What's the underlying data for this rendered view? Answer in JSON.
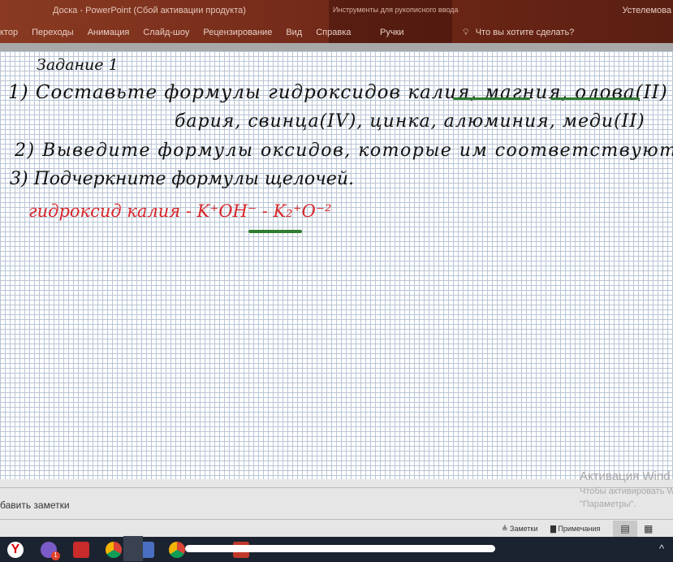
{
  "titlebar": {
    "title": "Доска  -  PowerPoint (Сбой активации продукта)",
    "context": "Инструменты для рукописного ввода",
    "user": "Устелемова"
  },
  "tabs": [
    "ктор",
    "Переходы",
    "Анимация",
    "Слайд-шоу",
    "Рецензирование",
    "Вид",
    "Справка"
  ],
  "context_tab": "Ручки",
  "tell_me": "Что вы хотите сделать?",
  "slide": {
    "heading": "Задание 1",
    "line1": "1) Составьте формулы гидроксидов калия, магния, олова(II)",
    "line2": "бария, свинца(IV), цинка, алюминия, меди(II)",
    "line3": "2) Выведите формулы оксидов, которые им соответствуют",
    "line4": "3) Подчеркните формулы щелочей.",
    "red_text": "гидроксид калия  -  K⁺OH⁻  -  K₂⁺O⁻²"
  },
  "notes_placeholder": "бавить заметки",
  "watermark": {
    "title": "Активация Wind",
    "line1": "Чтобы активировать W",
    "line2": "\"Параметры\"."
  },
  "status": {
    "notes": "Заметки",
    "comments": "Примечания"
  },
  "taskbar": {
    "badge1": "1"
  }
}
